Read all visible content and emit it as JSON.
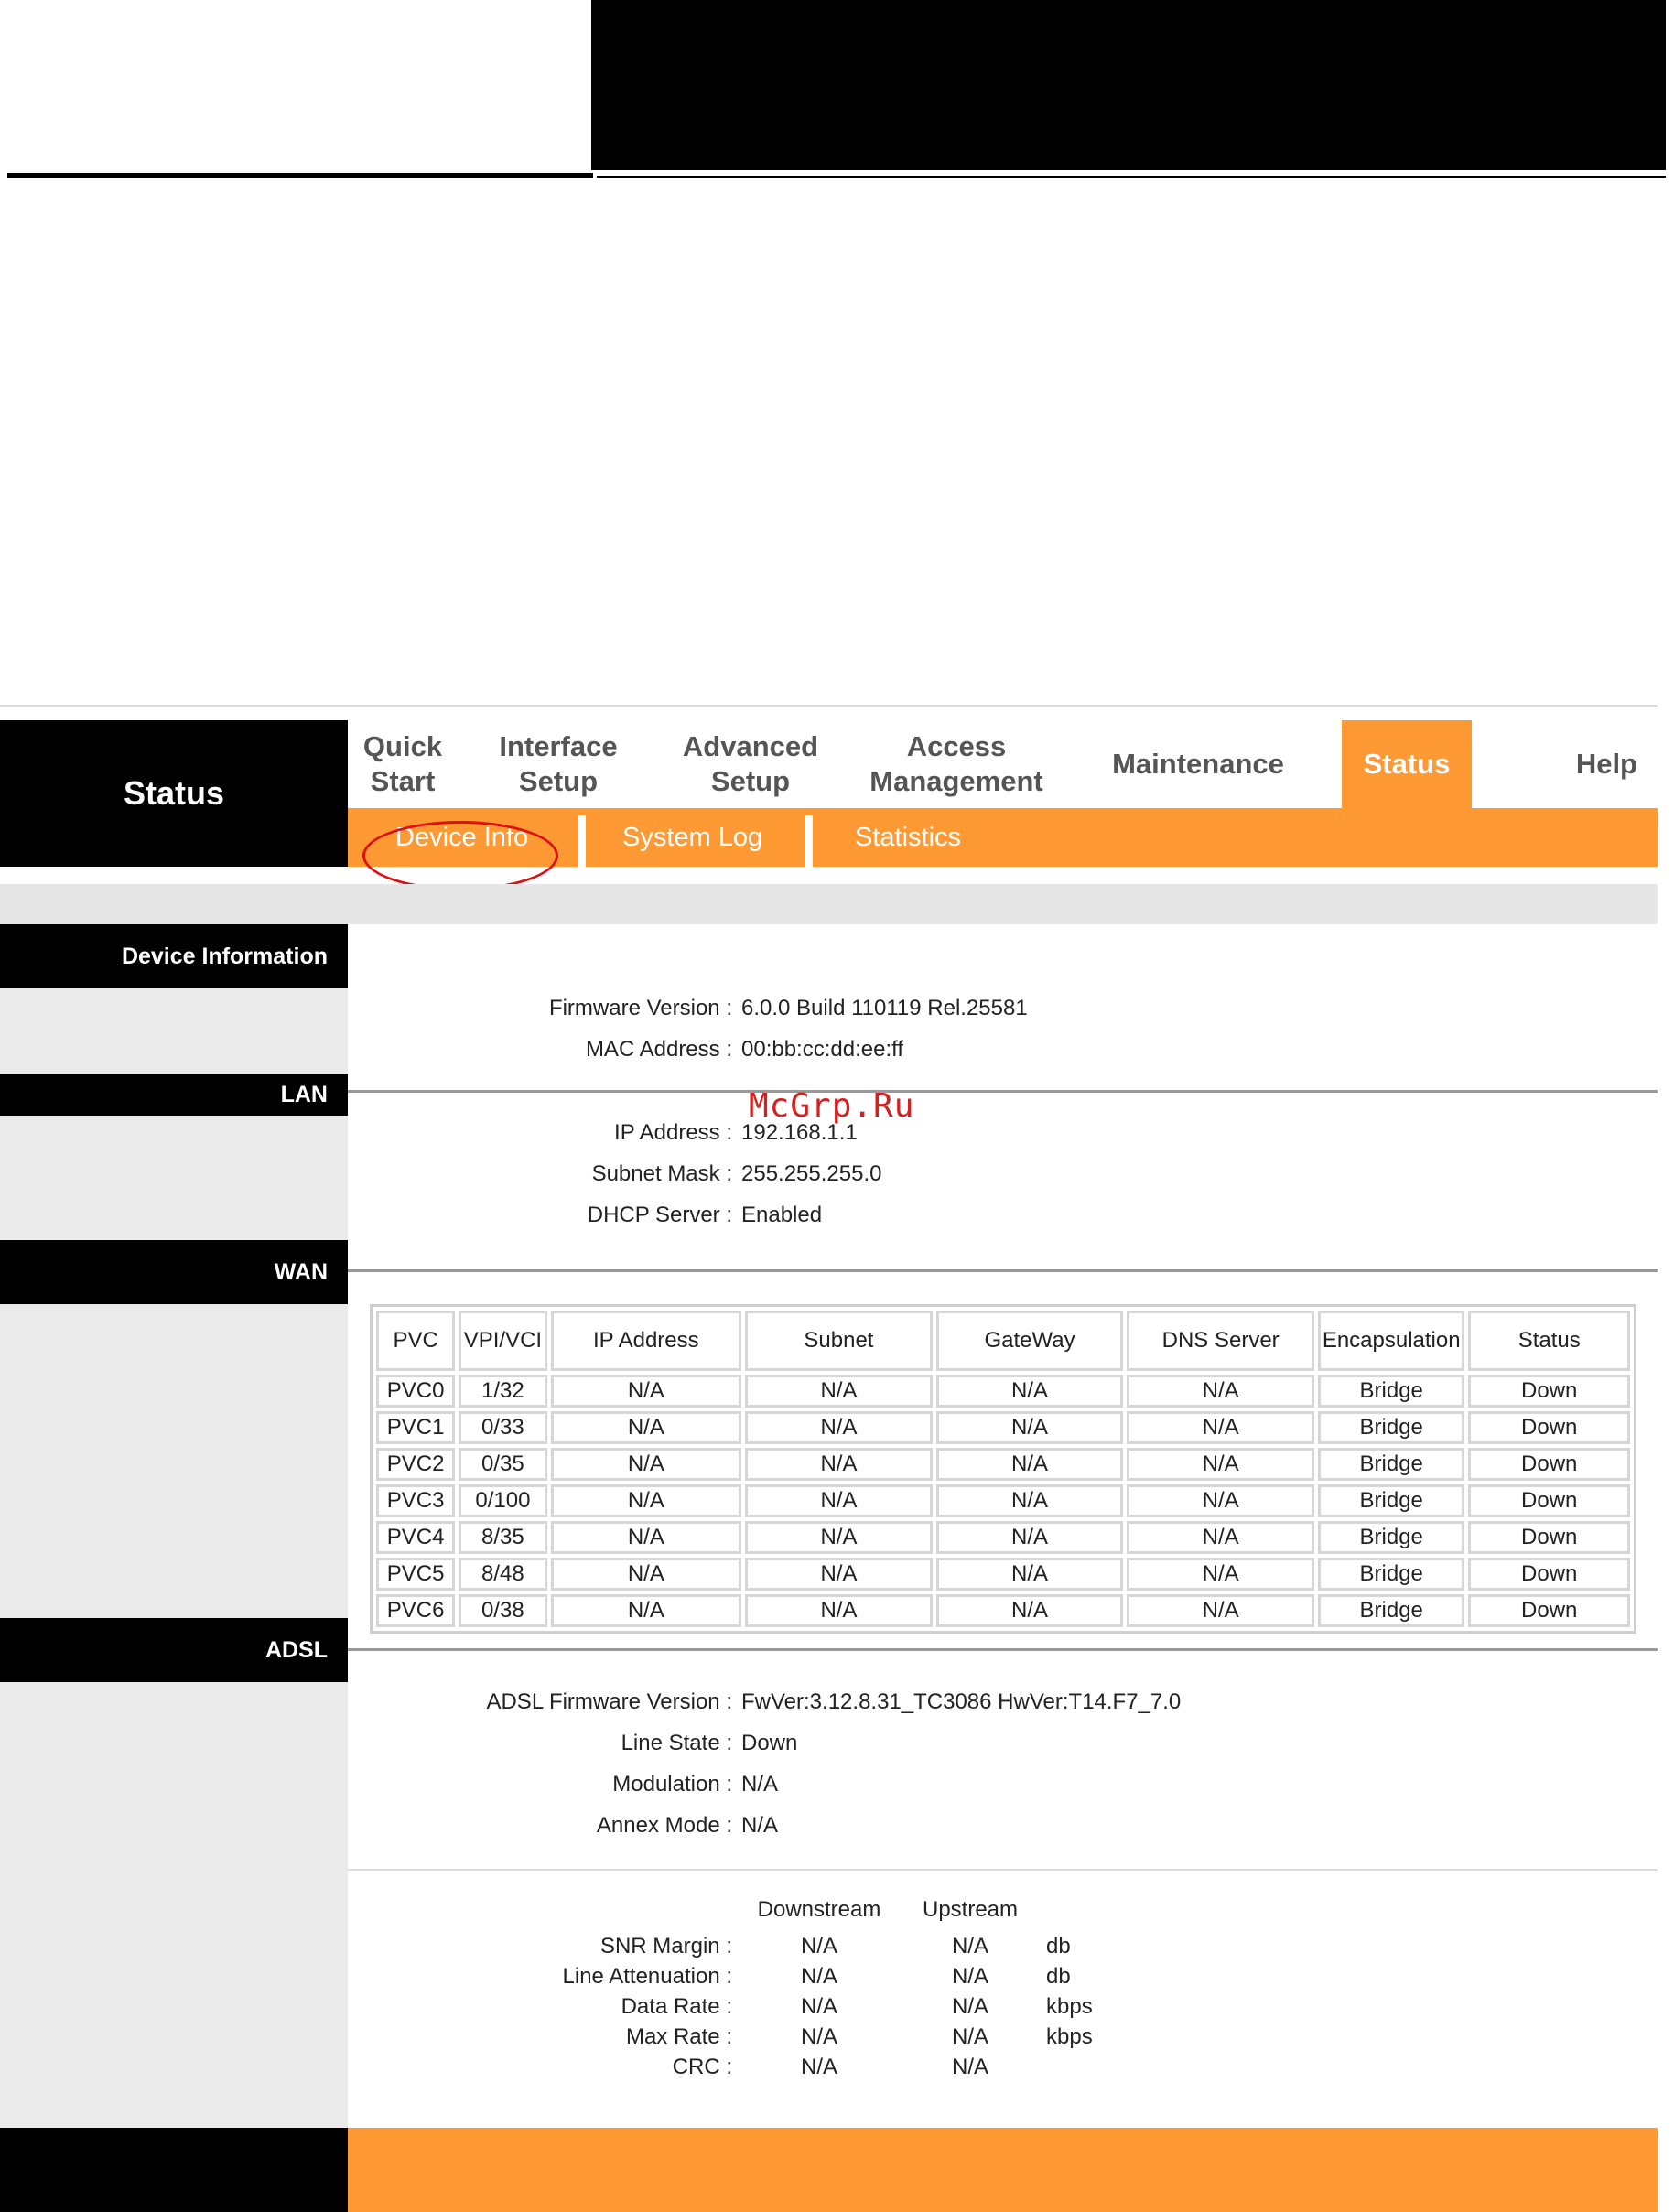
{
  "header": {
    "logo_label": "Status"
  },
  "menu": {
    "items": [
      {
        "label": "Quick\nStart"
      },
      {
        "label": "Interface\nSetup"
      },
      {
        "label": "Advanced\nSetup"
      },
      {
        "label": "Access\nManagement"
      },
      {
        "label": "Maintenance"
      },
      {
        "label": "Status",
        "active": true
      },
      {
        "label": "Help"
      }
    ]
  },
  "submenu": {
    "items": [
      {
        "label": "Device Info"
      },
      {
        "label": "System Log"
      },
      {
        "label": "Statistics"
      }
    ]
  },
  "sections": {
    "device": {
      "title": "Device Information",
      "firmware_label": "Firmware Version :",
      "firmware_value": "6.0.0 Build 110119 Rel.25581",
      "mac_label": "MAC Address :",
      "mac_value": "00:bb:cc:dd:ee:ff"
    },
    "lan": {
      "title": "LAN",
      "ip_label": "IP Address :",
      "ip_value": "192.168.1.1",
      "mask_label": "Subnet Mask :",
      "mask_value": "255.255.255.0",
      "dhcp_label": "DHCP Server :",
      "dhcp_value": "Enabled"
    },
    "wan": {
      "title": "WAN",
      "columns": [
        "PVC",
        "VPI/VCI",
        "IP Address",
        "Subnet",
        "GateWay",
        "DNS Server",
        "Encapsulation",
        "Status"
      ],
      "rows": [
        [
          "PVC0",
          "1/32",
          "N/A",
          "N/A",
          "N/A",
          "N/A",
          "Bridge",
          "Down"
        ],
        [
          "PVC1",
          "0/33",
          "N/A",
          "N/A",
          "N/A",
          "N/A",
          "Bridge",
          "Down"
        ],
        [
          "PVC2",
          "0/35",
          "N/A",
          "N/A",
          "N/A",
          "N/A",
          "Bridge",
          "Down"
        ],
        [
          "PVC3",
          "0/100",
          "N/A",
          "N/A",
          "N/A",
          "N/A",
          "Bridge",
          "Down"
        ],
        [
          "PVC4",
          "8/35",
          "N/A",
          "N/A",
          "N/A",
          "N/A",
          "Bridge",
          "Down"
        ],
        [
          "PVC5",
          "8/48",
          "N/A",
          "N/A",
          "N/A",
          "N/A",
          "Bridge",
          "Down"
        ],
        [
          "PVC6",
          "0/38",
          "N/A",
          "N/A",
          "N/A",
          "N/A",
          "Bridge",
          "Down"
        ]
      ]
    },
    "adsl": {
      "title": "ADSL",
      "fw_label": "ADSL Firmware Version :",
      "fw_value": "FwVer:3.12.8.31_TC3086 HwVer:T14.F7_7.0",
      "line_state_label": "Line State :",
      "line_state_value": "Down",
      "modulation_label": "Modulation :",
      "modulation_value": "N/A",
      "annex_label": "Annex Mode :",
      "annex_value": "N/A",
      "downstream_header": "Downstream",
      "upstream_header": "Upstream",
      "stats": [
        {
          "label": "SNR Margin :",
          "down": "N/A",
          "up": "N/A",
          "unit": "db"
        },
        {
          "label": "Line Attenuation :",
          "down": "N/A",
          "up": "N/A",
          "unit": "db"
        },
        {
          "label": "Data Rate :",
          "down": "N/A",
          "up": "N/A",
          "unit": "kbps"
        },
        {
          "label": "Max Rate :",
          "down": "N/A",
          "up": "N/A",
          "unit": "kbps"
        },
        {
          "label": "CRC :",
          "down": "N/A",
          "up": "N/A",
          "unit": ""
        }
      ]
    }
  },
  "watermark": "McGrp.Ru",
  "colors": {
    "accent": "#ff9933",
    "black": "#000000",
    "highlight_oval": "#dd1111"
  }
}
